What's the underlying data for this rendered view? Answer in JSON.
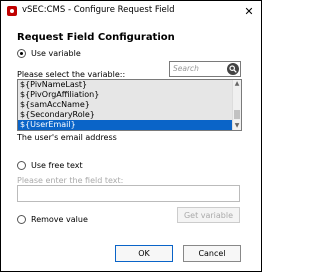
{
  "window": {
    "title": "vSEC:CMS - Configure Request Field",
    "close_glyph": "✕"
  },
  "heading": "Request Field Configuration",
  "options": {
    "use_variable": "Use variable",
    "use_free_text": "Use free text",
    "remove_value": "Remove value",
    "selected": "use_variable"
  },
  "variable_prompt": "Please select the variable::",
  "search": {
    "placeholder": "Search"
  },
  "variables": [
    "${PivNameLast}",
    "${PivOrgAffiliation}",
    "${samAccName}",
    "${SecondaryRole}",
    "${UserEmail}"
  ],
  "selected_variable": "${UserEmail}",
  "variable_description": "The user's email address",
  "free_text": {
    "prompt": "Please enter the field text:",
    "value": ""
  },
  "buttons": {
    "get_variable": "Get variable",
    "ok": "OK",
    "cancel": "Cancel"
  },
  "colors": {
    "selection": "#0a64c8",
    "app_icon": "#c00000"
  },
  "icons": {
    "app": "app-logo-icon",
    "search": "search-icon",
    "close": "close-icon"
  }
}
